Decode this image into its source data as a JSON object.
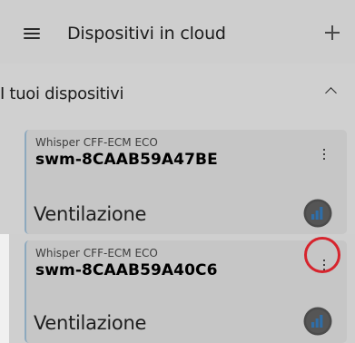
{
  "header": {
    "title": "Dispositivi in cloud",
    "menu_icon": "hamburger-menu-icon",
    "add_icon": "plus-icon"
  },
  "section": {
    "title": "I tuoi dispositivi",
    "toggle_icon": "chevron-up-icon"
  },
  "devices": [
    {
      "model": "Whisper CFF-ECM ECO",
      "serial": "swm-8CAAB59A47BE",
      "mode": "Ventilazione",
      "menu_icon": "kebab-menu-icon",
      "status_icon": "ventilation-level-icon"
    },
    {
      "model": "Whisper CFF-ECM ECO",
      "serial": "swm-8CAAB59A40C6",
      "mode": "Ventilazione",
      "menu_icon": "kebab-menu-icon",
      "status_icon": "ventilation-level-icon"
    }
  ],
  "colors": {
    "accent_blue": "#2f6ea8",
    "highlight_red": "#d6242d",
    "card_background": "#c6c6c6",
    "card_border": "#8da9be"
  }
}
